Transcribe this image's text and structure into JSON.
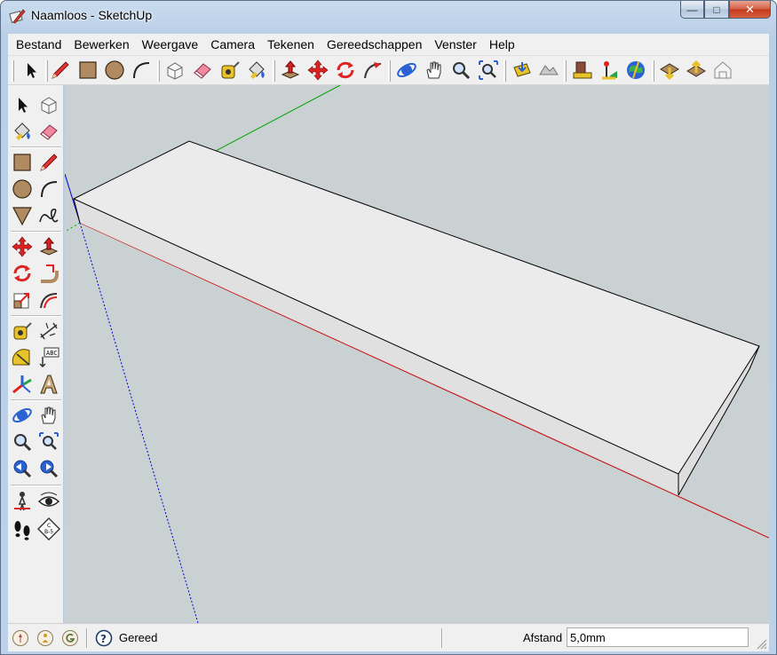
{
  "window": {
    "title": "Naamloos - SketchUp",
    "minimize_glyph": "—",
    "maximize_glyph": "□",
    "close_glyph": "✕"
  },
  "menubar": {
    "items": [
      "Bestand",
      "Bewerken",
      "Weergave",
      "Camera",
      "Tekenen",
      "Gereedschappen",
      "Venster",
      "Help"
    ]
  },
  "toolbar_top": {
    "icons": [
      "select-icon",
      "pencil-icon",
      "rectangle-icon",
      "circle-icon",
      "arc-icon",
      "make-component-icon",
      "eraser-icon",
      "tape-measure-icon",
      "paint-bucket-icon",
      "push-pull-icon",
      "move-icon",
      "rotate-icon",
      "follow-me-icon",
      "orbit-icon",
      "pan-icon",
      "zoom-icon",
      "zoom-extents-icon",
      "add-location-icon",
      "toggle-terrain-icon",
      "get-models-icon",
      "share-model-icon",
      "google-earth-icon",
      "get-models-2-icon",
      "share-component-icon",
      "3d-warehouse-icon"
    ]
  },
  "toolbar_left": {
    "icons": [
      "select-icon",
      "make-component-icon",
      "paint-bucket-icon",
      "eraser-icon",
      "rectangle-icon",
      "pencil-icon",
      "circle-icon",
      "arc-icon",
      "polygon-icon",
      "freehand-icon",
      "move-icon",
      "push-pull-icon",
      "rotate-icon",
      "follow-me-icon",
      "scale-icon",
      "offset-icon",
      "tape-measure-icon",
      "dimension-icon",
      "protractor-icon",
      "text-icon",
      "axes-icon",
      "3d-text-icon",
      "orbit-icon",
      "pan-icon",
      "zoom-icon",
      "zoom-window-icon",
      "previous-view-icon",
      "next-view-icon",
      "position-camera-icon",
      "look-around-icon",
      "walk-icon",
      "section-plane-icon"
    ]
  },
  "statusbar": {
    "status_text": "Gereed",
    "measure_label": "Afstand",
    "measure_value": "5,0mm",
    "icons": [
      "geo-location-icon",
      "credits-icon",
      "google-signin-icon",
      "help-icon"
    ]
  },
  "colors": {
    "viewport_bg": "#c9d1d3",
    "axis_red": "#cc0000",
    "axis_green": "#00a000",
    "axis_blue": "#0000cc",
    "face_top": "#ebebeb",
    "face_side": "#e0e0e0"
  }
}
